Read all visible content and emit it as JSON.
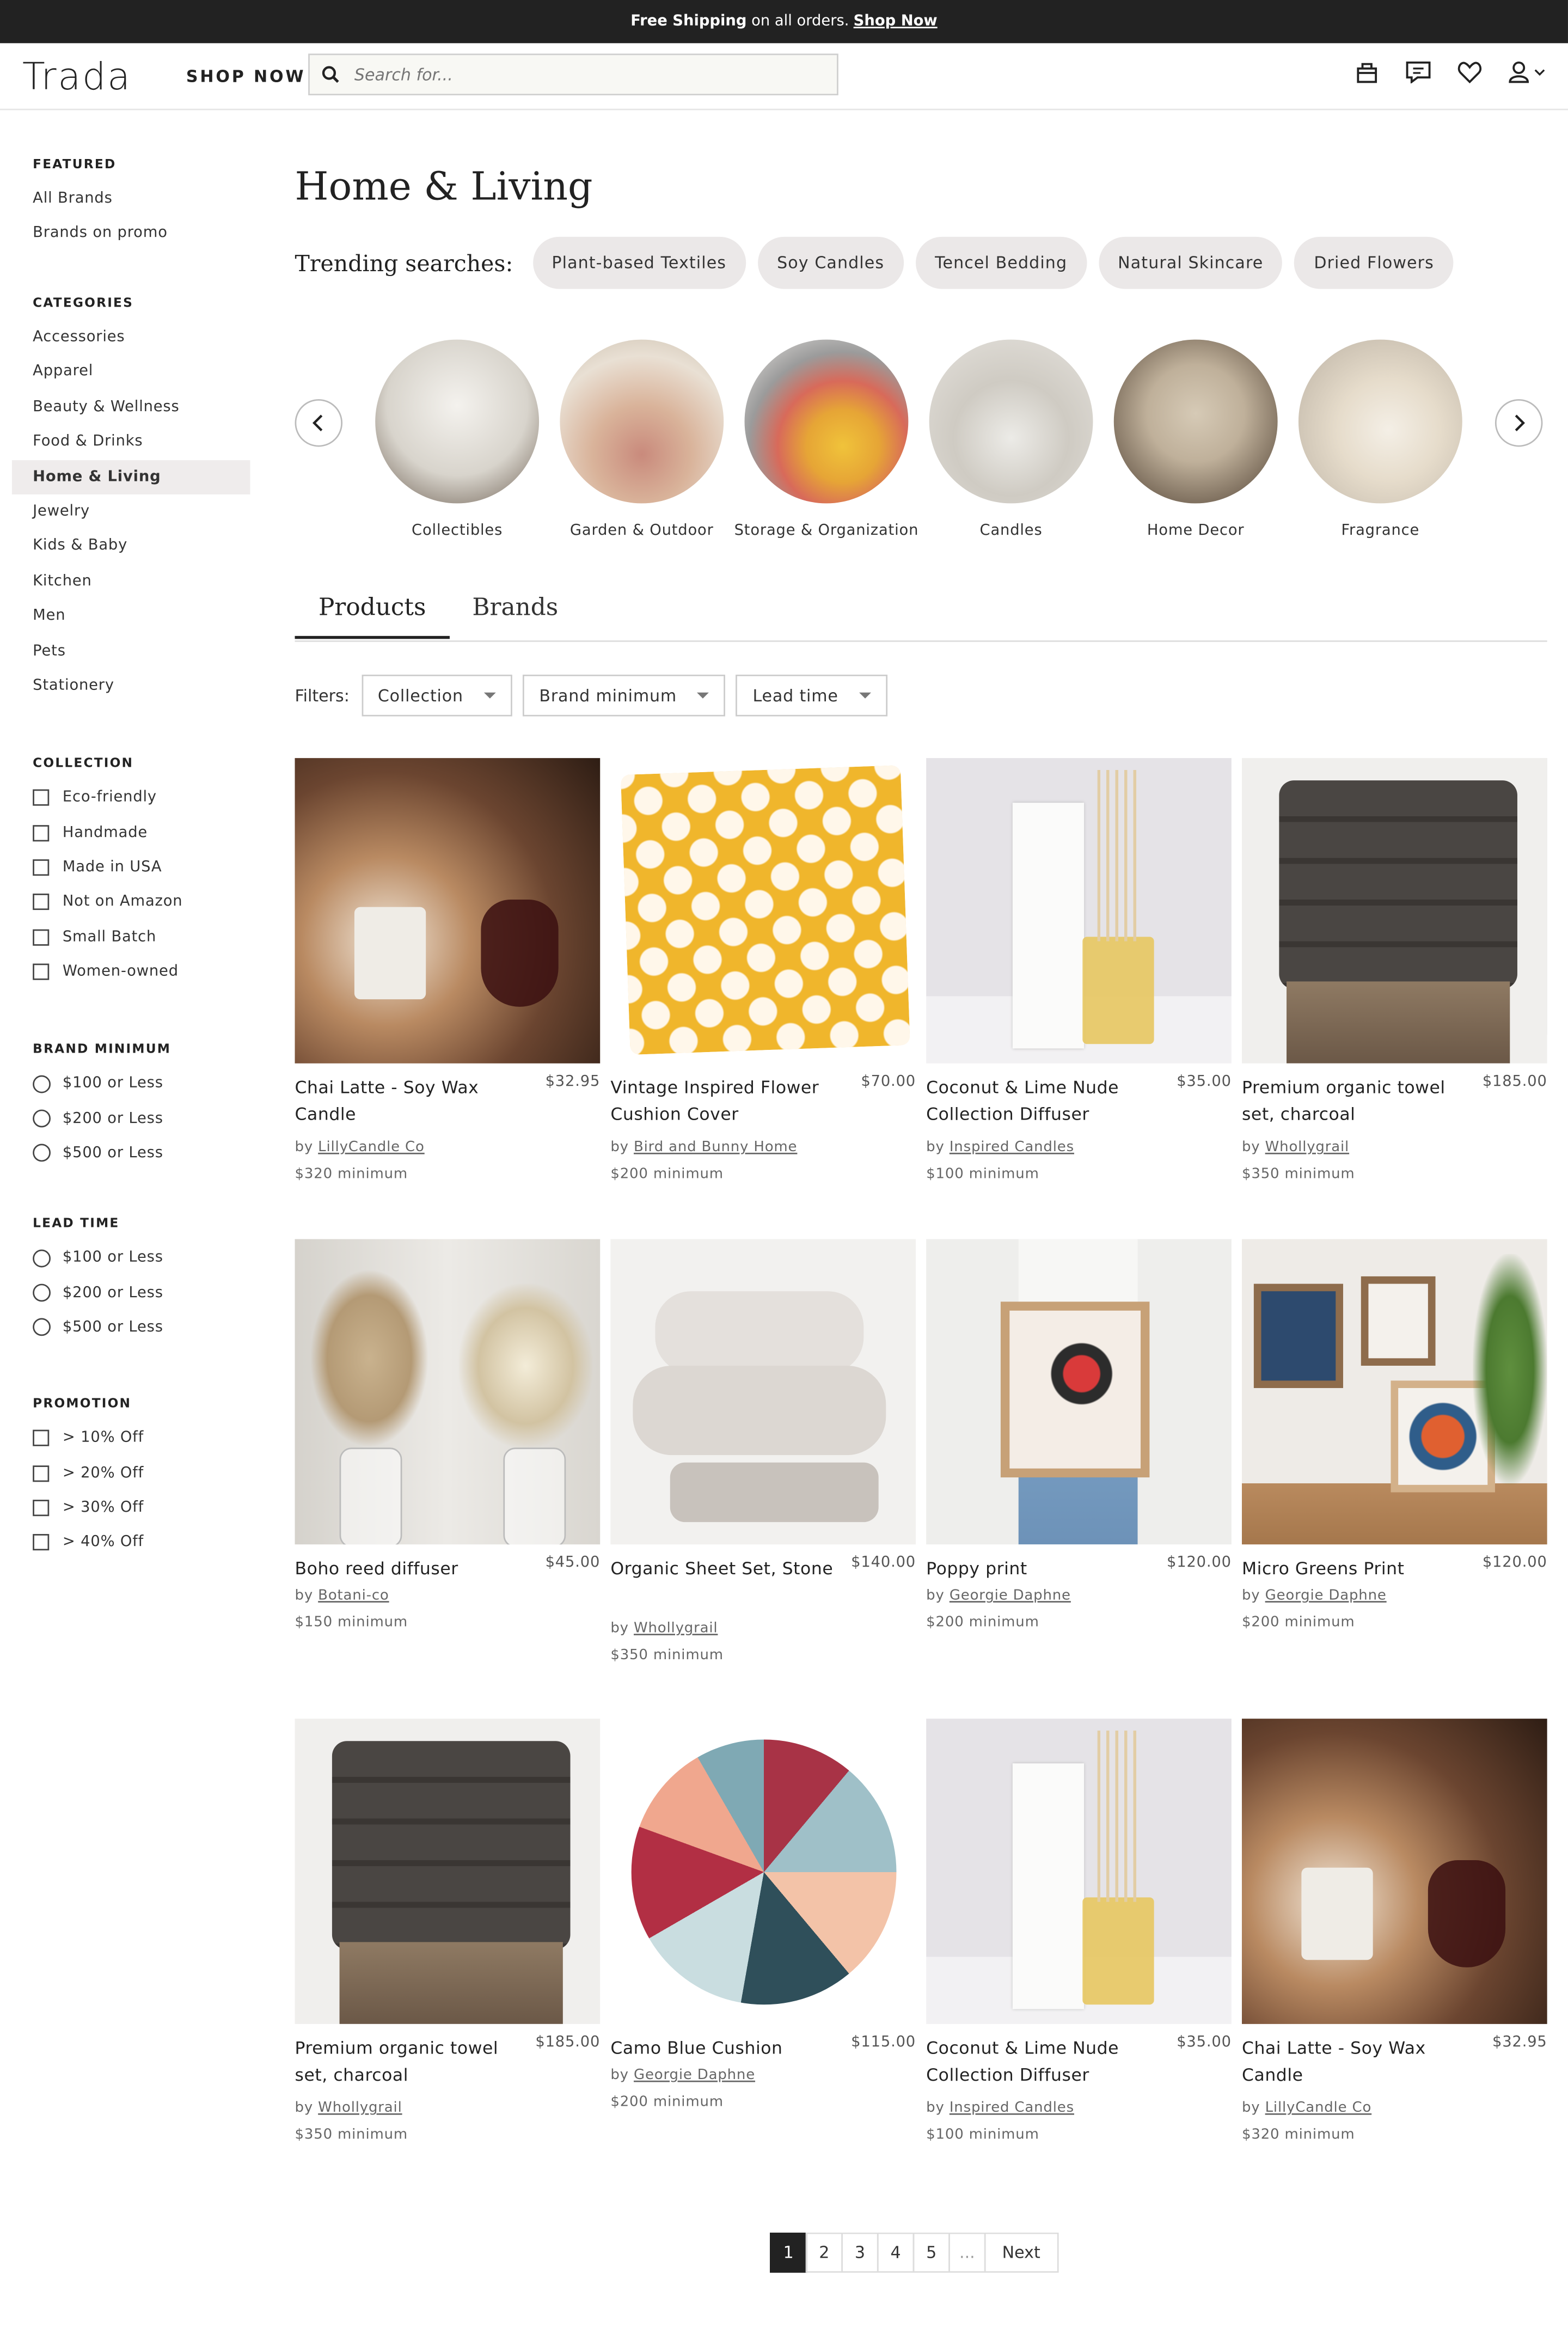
{
  "banner": {
    "bold": "Free Shipping",
    "text": "on all orders.",
    "link": "Shop Now"
  },
  "header": {
    "logo": "Trada",
    "shop_now": "SHOP NOW",
    "search_placeholder": "Search for..."
  },
  "sidebar": {
    "featured": {
      "heading": "FEATURED",
      "items": [
        "All Brands",
        "Brands on promo"
      ]
    },
    "categories": {
      "heading": "CATEGORIES",
      "items": [
        "Accessories",
        "Apparel",
        "Beauty & Wellness",
        "Food & Drinks",
        "Home & Living",
        "Jewelry",
        "Kids & Baby",
        "Kitchen",
        "Men",
        "Pets",
        "Stationery"
      ],
      "active": "Home & Living"
    },
    "collection": {
      "heading": "COLLECTION",
      "items": [
        "Eco-friendly",
        "Handmade",
        "Made in USA",
        "Not on Amazon",
        "Small Batch",
        "Women-owned"
      ]
    },
    "brand_minimum": {
      "heading": "BRAND MINIMUM",
      "items": [
        "$100 or Less",
        "$200 or Less",
        "$500 or Less"
      ]
    },
    "lead_time": {
      "heading": "LEAD TIME",
      "items": [
        "$100 or Less",
        "$200 or Less",
        "$500 or Less"
      ]
    },
    "promotion": {
      "heading": "PROMOTION",
      "items": [
        "> 10% Off",
        "> 20% Off",
        "> 30% Off",
        "> 40% Off"
      ]
    }
  },
  "main": {
    "title": "Home & Living",
    "trending_label": "Trending searches:",
    "trending": [
      "Plant-based Textiles",
      "Soy Candles",
      "Tencel Bedding",
      "Natural Skincare",
      "Dried Flowers"
    ],
    "categories": [
      {
        "label": "Collectibles"
      },
      {
        "label": "Garden & Outdoor"
      },
      {
        "label": "Storage & Organization"
      },
      {
        "label": "Candles"
      },
      {
        "label": "Home Decor"
      },
      {
        "label": "Fragrance"
      }
    ],
    "tabs": [
      "Products",
      "Brands"
    ],
    "filters_label": "Filters:",
    "filters": [
      "Collection",
      "Brand minimum",
      "Lead time"
    ]
  },
  "products": [
    {
      "name": "Chai Latte - Soy Wax Candle",
      "price": "$32.95",
      "by": "by",
      "brand": "LillyCandle Co",
      "min": "$320 minimum"
    },
    {
      "name": "Vintage Inspired Flower Cushion Cover",
      "price": "$70.00",
      "by": "by",
      "brand": "Bird and Bunny Home",
      "min": "$200 minimum"
    },
    {
      "name": "Coconut & Lime Nude Collection Diffuser",
      "price": "$35.00",
      "by": "by",
      "brand": "Inspired Candles",
      "min": "$100 minimum"
    },
    {
      "name": "Premium organic towel set, charcoal",
      "price": "$185.00",
      "by": "by",
      "brand": "Whollygrail",
      "min": "$350 minimum"
    },
    {
      "name": "Boho reed diffuser",
      "price": "$45.00",
      "by": "by",
      "brand": "Botani-co",
      "min": "$150 minimum"
    },
    {
      "name": "Organic Sheet Set, Stone",
      "price": "$140.00",
      "by": "by",
      "brand": "Whollygrail",
      "min": "$350 minimum"
    },
    {
      "name": "Poppy print",
      "price": "$120.00",
      "by": "by",
      "brand": "Georgie Daphne",
      "min": "$200 minimum"
    },
    {
      "name": "Micro Greens Print",
      "price": "$120.00",
      "by": "by",
      "brand": "Georgie Daphne",
      "min": "$200 minimum"
    },
    {
      "name": "Premium organic towel set, charcoal",
      "price": "$185.00",
      "by": "by",
      "brand": "Whollygrail",
      "min": "$350 minimum"
    },
    {
      "name": "Camo Blue Cushion",
      "price": "$115.00",
      "by": "by",
      "brand": "Georgie Daphne",
      "min": "$200 minimum"
    },
    {
      "name": "Coconut & Lime Nude Collection Diffuser",
      "price": "$35.00",
      "by": "by",
      "brand": "Inspired Candles",
      "min": "$100 minimum"
    },
    {
      "name": "Chai Latte - Soy Wax Candle",
      "price": "$32.95",
      "by": "by",
      "brand": "LillyCandle Co",
      "min": "$320 minimum"
    }
  ],
  "pagination": {
    "pages": [
      "1",
      "2",
      "3",
      "4",
      "5",
      "..."
    ],
    "next": "Next",
    "active": "1"
  },
  "colors": {
    "banner_bg": "#222222",
    "active_page": "#222222",
    "chip_bg": "#ebe8e8",
    "active_category_bg": "#efecec"
  }
}
